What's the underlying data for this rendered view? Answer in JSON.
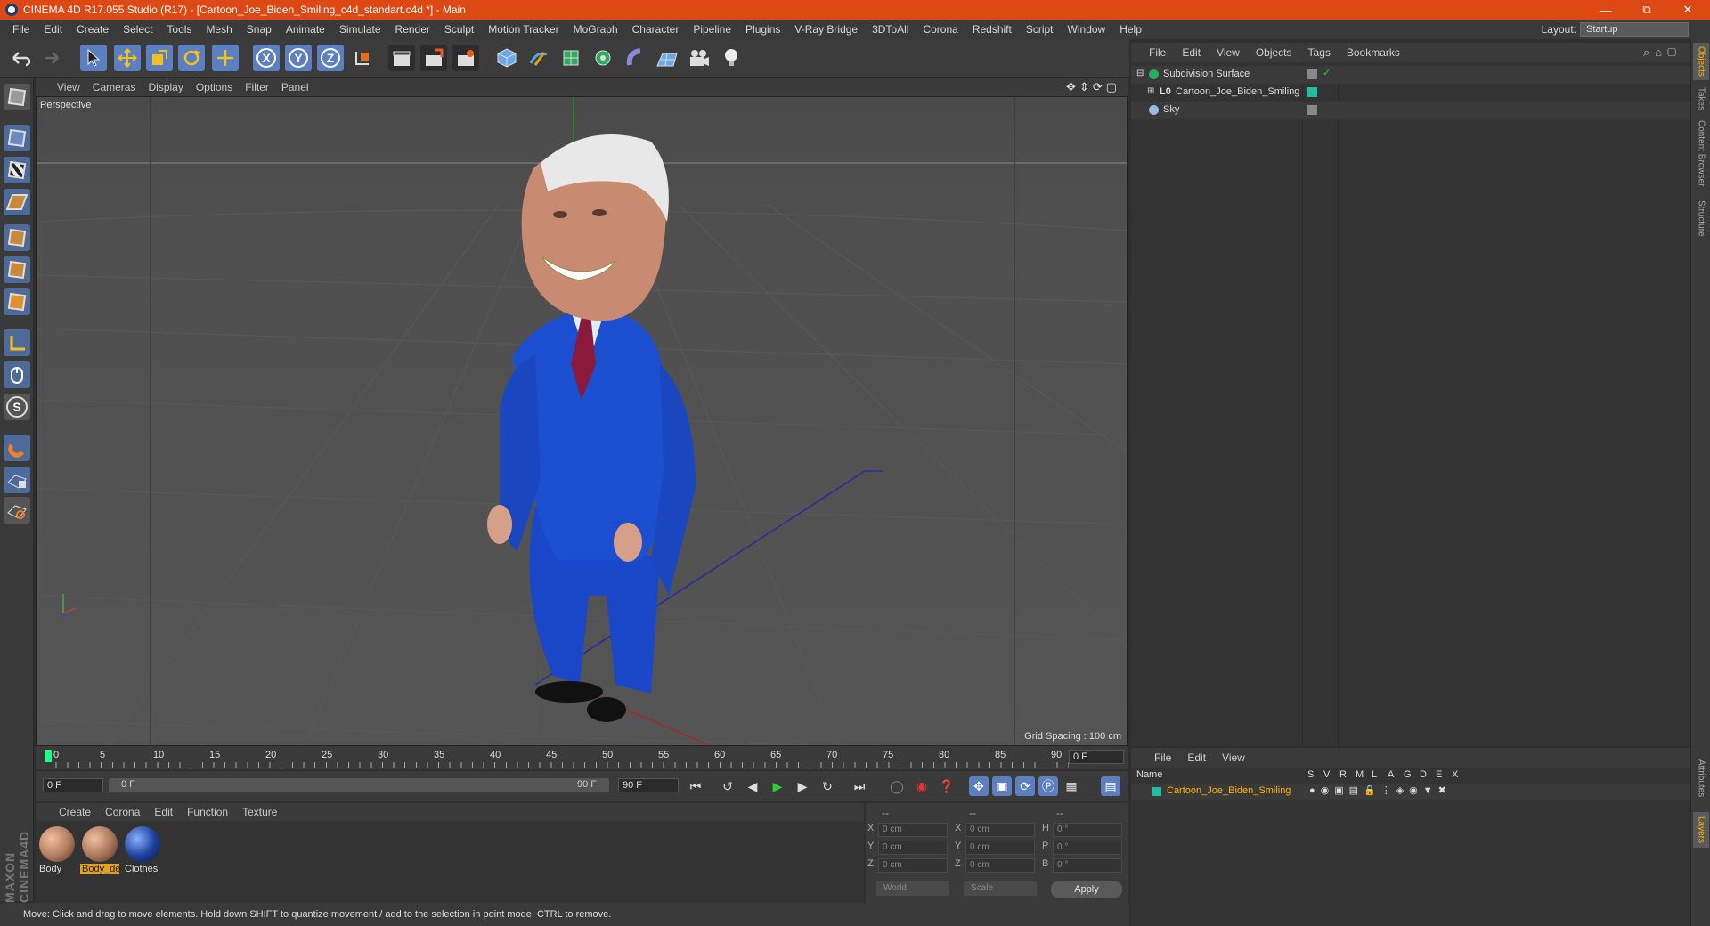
{
  "window": {
    "title": "CINEMA 4D R17.055 Studio (R17) - [Cartoon_Joe_Biden_Smiling_c4d_standart.c4d *] - Main"
  },
  "menu": [
    "File",
    "Edit",
    "Create",
    "Select",
    "Tools",
    "Mesh",
    "Snap",
    "Animate",
    "Simulate",
    "Render",
    "Sculpt",
    "Motion Tracker",
    "MoGraph",
    "Character",
    "Pipeline",
    "Plugins",
    "V-Ray Bridge",
    "3DToAll",
    "Corona",
    "Redshift",
    "Script",
    "Window",
    "Help"
  ],
  "layout": {
    "label": "Layout:",
    "value": "Startup"
  },
  "viewport": {
    "menu": [
      "View",
      "Cameras",
      "Display",
      "Options",
      "Filter",
      "Panel"
    ],
    "label": "Perspective",
    "grid_spacing": "Grid Spacing : 100 cm"
  },
  "timeline": {
    "ticks": [
      "0",
      "5",
      "10",
      "15",
      "20",
      "25",
      "30",
      "35",
      "40",
      "45",
      "50",
      "55",
      "60",
      "65",
      "70",
      "75",
      "80",
      "85",
      "90"
    ],
    "current_frame": "0 F"
  },
  "playbar": {
    "start": "0 F",
    "slider_start": "0 F",
    "slider_end": "90 F",
    "end": "90 F"
  },
  "materials": {
    "menu": [
      "Create",
      "Corona",
      "Edit",
      "Function",
      "Texture"
    ],
    "items": [
      {
        "name": "Body",
        "color": "#b07a5e"
      },
      {
        "name": "Body_de",
        "color": "#a8735a"
      },
      {
        "name": "Clothes",
        "color": "#1a3e9a"
      }
    ]
  },
  "coordinates": {
    "headers": [
      "--",
      "--",
      "--"
    ],
    "rows": [
      {
        "a": "X",
        "av": "0 cm",
        "b": "X",
        "bv": "0 cm",
        "c": "H",
        "cv": "0 °"
      },
      {
        "a": "Y",
        "av": "0 cm",
        "b": "Y",
        "bv": "0 cm",
        "c": "P",
        "cv": "0 °"
      },
      {
        "a": "Z",
        "av": "0 cm",
        "b": "Z",
        "bv": "0 cm",
        "c": "B",
        "cv": "0 °"
      }
    ],
    "mode1": "World",
    "mode2": "Scale",
    "apply": "Apply"
  },
  "status": "Move: Click and drag to move elements. Hold down SHIFT to quantize movement / add to the selection in point mode, CTRL to remove.",
  "objects": {
    "menu": [
      "File",
      "Edit",
      "View",
      "Objects",
      "Tags",
      "Bookmarks"
    ],
    "items": [
      {
        "name": "Subdivision Surface"
      },
      {
        "name": "Cartoon_Joe_Biden_Smiling"
      },
      {
        "name": "Sky"
      }
    ]
  },
  "layers": {
    "menu": [
      "File",
      "Edit",
      "View"
    ],
    "columns": [
      "Name",
      "S",
      "V",
      "R",
      "M",
      "L",
      "A",
      "G",
      "D",
      "E",
      "X"
    ],
    "row": "Cartoon_Joe_Biden_Smiling"
  },
  "right_tabs": [
    "Objects",
    "Takes",
    "Content Browser",
    "Structure",
    "Attributes",
    "Layers"
  ],
  "colors": {
    "accent": "#5b7fbf",
    "title_bar": "#dd4815",
    "highlight": "#ffb000"
  }
}
